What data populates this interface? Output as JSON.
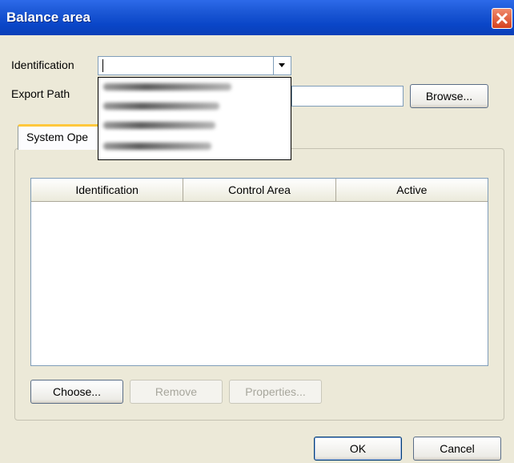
{
  "window": {
    "title": "Balance area"
  },
  "form": {
    "identification_label": "Identification",
    "identification_value": "",
    "export_path_label": "Export Path",
    "export_path_value": "",
    "browse_label": "Browse..."
  },
  "dropdown": {
    "items": [
      {
        "label": ""
      },
      {
        "label": ""
      },
      {
        "label": ""
      },
      {
        "label": ""
      }
    ]
  },
  "tab": {
    "label": "System Ope"
  },
  "table": {
    "columns": [
      "Identification",
      "Control Area",
      "Active"
    ],
    "rows": []
  },
  "actions": {
    "choose": "Choose...",
    "remove": "Remove",
    "properties": "Properties..."
  },
  "dialog_buttons": {
    "ok": "OK",
    "cancel": "Cancel"
  },
  "colors": {
    "titlebar": "#0A46C8",
    "close": "#D4411E",
    "dialog_bg": "#ECE9D8"
  }
}
